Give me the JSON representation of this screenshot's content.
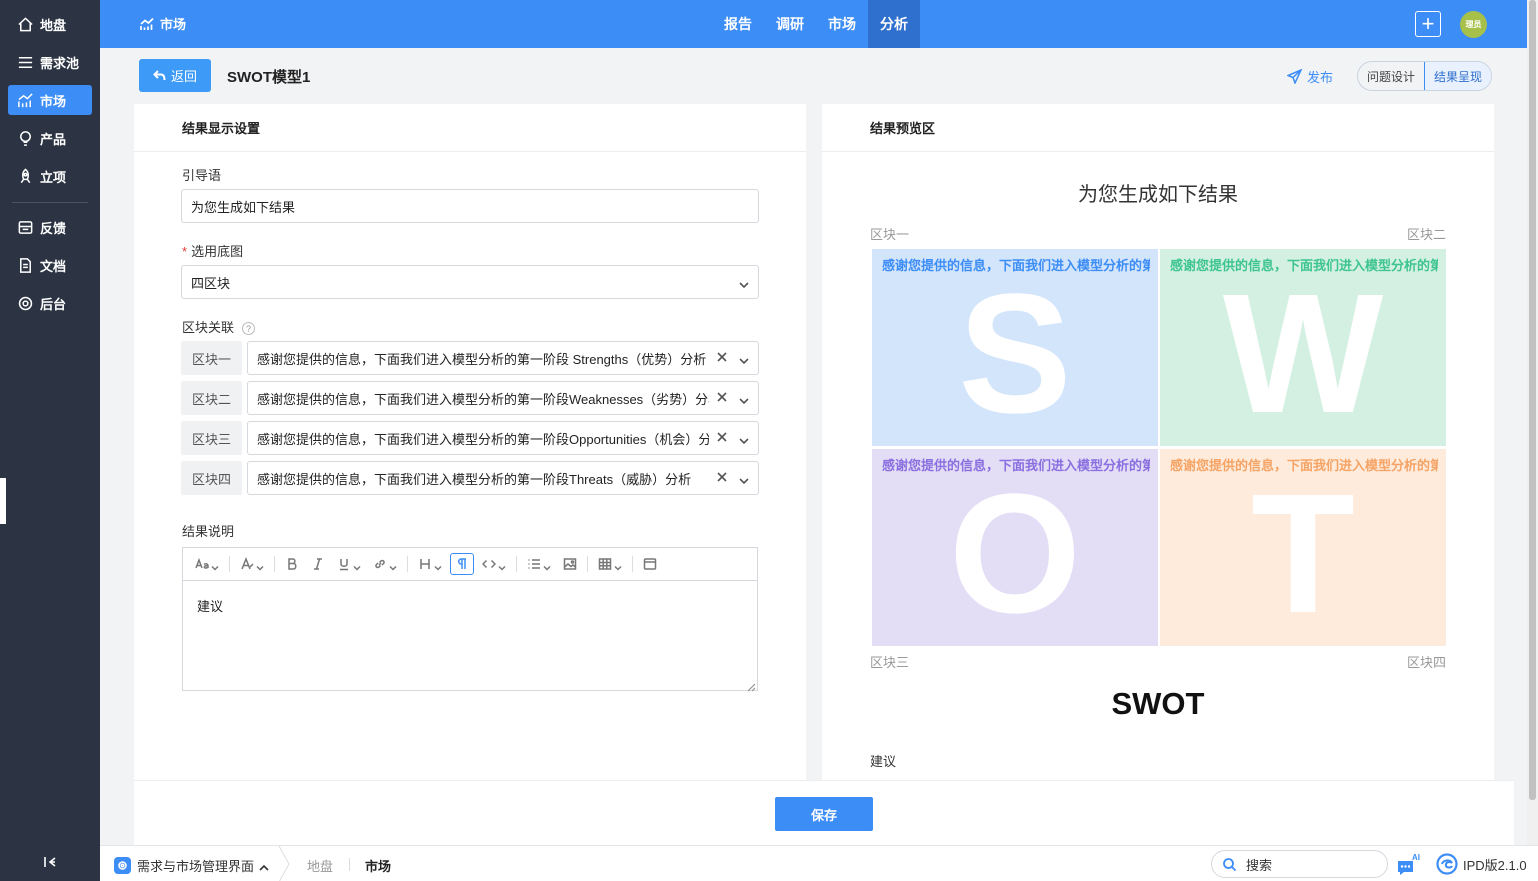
{
  "sidebar": {
    "items": [
      {
        "label": "地盘",
        "icon": "home-icon"
      },
      {
        "label": "需求池",
        "icon": "list-icon"
      },
      {
        "label": "市场",
        "icon": "chart-line-icon"
      },
      {
        "label": "产品",
        "icon": "bulb-icon"
      },
      {
        "label": "立项",
        "icon": "rocket-icon"
      },
      {
        "label": "反馈",
        "icon": "feedback-icon"
      },
      {
        "label": "文档",
        "icon": "document-icon"
      },
      {
        "label": "后台",
        "icon": "gear-icon"
      }
    ],
    "active_index": 2
  },
  "topbar": {
    "module_title": "市场",
    "nav": [
      "报告",
      "调研",
      "市场",
      "分析"
    ],
    "active_nav": "分析",
    "user_badge": "理员",
    "accent_color": "#3d8df6"
  },
  "header": {
    "back_label": "返回",
    "title": "SWOT模型1",
    "publish_label": "发布",
    "tabs": [
      "问题设计",
      "结果呈现"
    ],
    "active_tab": "结果呈现"
  },
  "settings": {
    "panel_title": "结果显示设置",
    "intro_label": "引导语",
    "intro_value": "为您生成如下结果",
    "base_label": "选用底图",
    "base_value": "四区块",
    "link_label": "区块关联",
    "help_mark": "?",
    "blocks": [
      {
        "tag": "区块一",
        "value": "感谢您提供的信息，下面我们进入模型分析的第一阶段 Strengths（优势）分析"
      },
      {
        "tag": "区块二",
        "value": "感谢您提供的信息，下面我们进入模型分析的第一阶段Weaknesses（劣势）分析"
      },
      {
        "tag": "区块三",
        "value": "感谢您提供的信息，下面我们进入模型分析的第一阶段Opportunities（机会）分析"
      },
      {
        "tag": "区块四",
        "value": "感谢您提供的信息，下面我们进入模型分析的第一阶段Threats（威胁）分析"
      }
    ],
    "desc_label": "结果说明",
    "editor_content": "建议"
  },
  "preview": {
    "panel_title": "结果预览区",
    "heading": "为您生成如下结果",
    "corners": [
      "区块一",
      "区块二",
      "区块三",
      "区块四"
    ],
    "quadrants": [
      {
        "text": "感谢您提供的信息，下面我们进入模型分析的第一阶段",
        "letter": "S",
        "bg": "#d3e5fb",
        "color": "#3d8df6"
      },
      {
        "text": "感谢您提供的信息，下面我们进入模型分析的第一阶段",
        "letter": "W",
        "bg": "#d3f0e2",
        "color": "#3ec58f"
      },
      {
        "text": "感谢您提供的信息，下面我们进入模型分析的第一阶段",
        "letter": "O",
        "bg": "#e3def5",
        "color": "#8a6fe0"
      },
      {
        "text": "感谢您提供的信息，下面我们进入模型分析的第一阶段",
        "letter": "T",
        "bg": "#feebdb",
        "color": "#f5a466"
      }
    ],
    "big_title": "SWOT",
    "desc": "建议"
  },
  "footer": {
    "save_label": "保存"
  },
  "bottombar": {
    "app_name": "需求与市场管理界面",
    "tabs": [
      "地盘",
      "市场"
    ],
    "active_tab": "市场",
    "search_placeholder": "搜索",
    "ai_label": "AI",
    "version": "IPD版2.1.0"
  }
}
